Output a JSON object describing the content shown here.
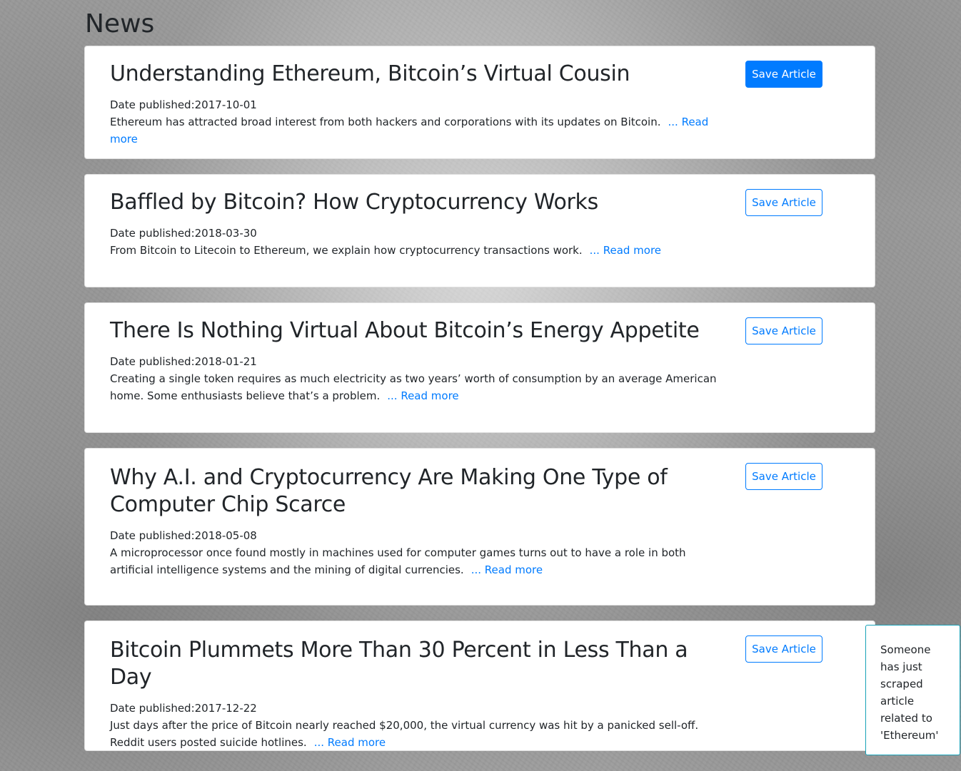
{
  "page": {
    "heading": "News"
  },
  "articles": [
    {
      "title": "Understanding Ethereum, Bitcoin’s Virtual Cousin",
      "date_label": "Date published:",
      "date": "2017-10-01",
      "summary": "Ethereum has attracted broad interest from both hackers and corporations with its updates on Bitcoin.",
      "read_more": "... Read more",
      "save_label": "Save Article",
      "saved_style": "primary"
    },
    {
      "title": "Baffled by Bitcoin? How Cryptocurrency Works",
      "date_label": "Date published:",
      "date": "2018-03-30",
      "summary": "From Bitcoin to Litecoin to Ethereum, we explain how cryptocurrency transactions work.",
      "read_more": "... Read more",
      "save_label": "Save Article",
      "saved_style": "outline"
    },
    {
      "title": "There Is Nothing Virtual About Bitcoin’s Energy Appetite",
      "date_label": "Date published:",
      "date": "2018-01-21",
      "summary": "Creating a single token requires as much electricity as two years’ worth of consumption by an average American home. Some enthusiasts believe that’s a problem.",
      "read_more": "... Read more",
      "save_label": "Save Article",
      "saved_style": "outline"
    },
    {
      "title": "Why A.I. and Cryptocurrency Are Making One Type of Computer Chip Scarce",
      "date_label": "Date published:",
      "date": "2018-05-08",
      "summary": "A microprocessor once found mostly in machines used for computer games turns out to have a role in both artificial intelligence systems and the mining of digital currencies.",
      "read_more": "... Read more",
      "save_label": "Save Article",
      "saved_style": "outline"
    },
    {
      "title": "Bitcoin Plummets More Than 30 Percent in Less Than a Day",
      "date_label": "Date published:",
      "date": "2017-12-22",
      "summary": "Just days after the price of Bitcoin nearly reached $20,000, the virtual currency was hit by a panicked sell-off. Reddit users posted suicide hotlines.",
      "read_more": "... Read more",
      "save_label": "Save Article",
      "saved_style": "outline"
    }
  ],
  "toast": {
    "message": "Someone has just scraped article related to 'Ethereum'"
  },
  "colors": {
    "primary": "#007bff",
    "toast_border": "#17a2b8"
  }
}
